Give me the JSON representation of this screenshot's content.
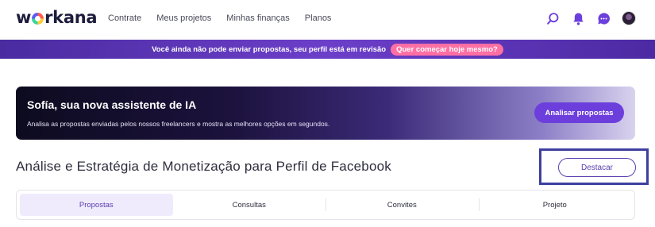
{
  "nav": {
    "logo": "workana",
    "links": [
      "Contrate",
      "Meus projetos",
      "Minhas finanças",
      "Planos"
    ],
    "icons": [
      "search-icon",
      "bell-icon",
      "chat-icon",
      "avatar"
    ],
    "accent": "#6c3fdc"
  },
  "banner": {
    "message": "Você ainda não pode enviar propostas, seu perfil está em revisão",
    "cta": "Quer começar hoje mesmo?"
  },
  "ai_card": {
    "title": "Sofía, sua nova assistente de IA",
    "description": "Analisa as propostas enviadas pelos nossos freelancers e mostra as melhores opções em segundos.",
    "button": "Analisar propostas"
  },
  "project": {
    "title": "Análise e Estratégia de Monetização para Perfil de Facebook",
    "highlight_button": "Destacar"
  },
  "tabs": [
    {
      "label": "Propostas",
      "active": true
    },
    {
      "label": "Consultas",
      "active": false
    },
    {
      "label": "Convites",
      "active": false
    },
    {
      "label": "Projeto",
      "active": false
    }
  ]
}
